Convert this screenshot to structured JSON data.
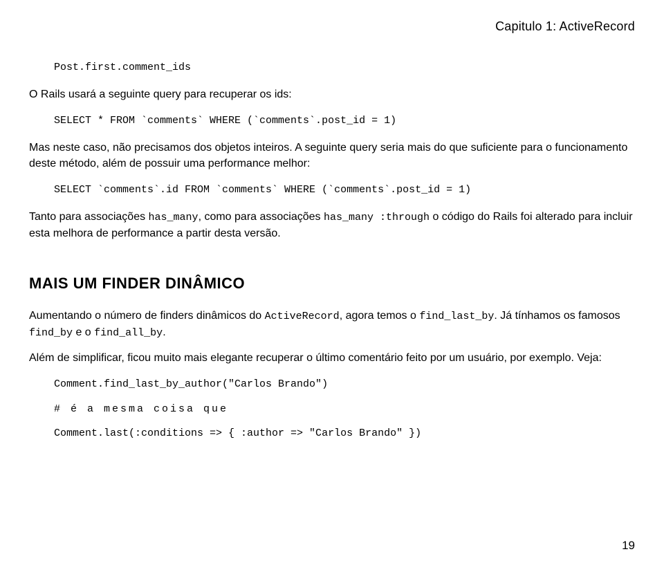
{
  "header": {
    "chapter": "Capitulo 1: ActiveRecord"
  },
  "code": {
    "line1": "Post.first.comment_ids",
    "sql1": "SELECT * FROM `comments` WHERE (`comments`.post_id = 1)",
    "sql2": "SELECT `comments`.id FROM `comments` WHERE (`comments`.post_id = 1)",
    "ruby1": "Comment.find_last_by_author(\"Carlos Brando\")",
    "comment1": "# é a mesma coisa que",
    "ruby2": "Comment.last(:conditions => { :author => \"Carlos Brando\" })"
  },
  "para": {
    "p1": "O Rails usará a seguinte query para recuperar os ids:",
    "p2": "Mas neste caso, não precisamos dos objetos inteiros. A seguinte query seria mais do que suficiente para o funcionamento deste método, além de possuir uma performance melhor:",
    "p3a": "Tanto para associações ",
    "p3b": "has_many",
    "p3c": ", como para associações ",
    "p3d": "has_many :through",
    "p3e": " o código do Rails foi alterado para incluir esta melhora de performance a partir desta versão.",
    "p4a": "Aumentando o número de finders dinâmicos do ",
    "p4b": "ActiveRecord",
    "p4c": ", agora temos o ",
    "p4d": "find_last_by",
    "p4e": ". Já tínhamos os famosos ",
    "p4f": "find_by",
    "p4g": " e o ",
    "p4h": "find_all_by",
    "p4i": ".",
    "p5": "Além de simplificar, ficou muito mais elegante recuperar o último comentário feito por um usuário, por exemplo. Veja:"
  },
  "heading": {
    "h1": "MAIS UM FINDER DINÂMICO"
  },
  "footer": {
    "page_number": "19"
  }
}
